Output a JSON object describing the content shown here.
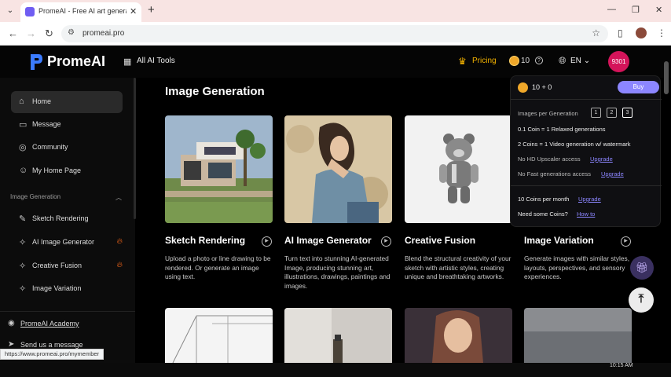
{
  "browser": {
    "tab_title": "PromeAI - Free AI art generator",
    "url": "promeai.pro",
    "status_url": "https://www.promeai.pro/mymember"
  },
  "header": {
    "logo": "PromeAI",
    "all_tools": "All AI Tools",
    "pricing": "Pricing",
    "coins": "10",
    "language": "EN",
    "user": "9301"
  },
  "sidebar": {
    "items": [
      {
        "label": "Home",
        "icon": "home-icon"
      },
      {
        "label": "Message",
        "icon": "message-icon"
      },
      {
        "label": "Community",
        "icon": "community-icon"
      },
      {
        "label": "My Home Page",
        "icon": "user-icon"
      }
    ],
    "section": "Image Generation",
    "tools": [
      {
        "label": "Sketch Rendering",
        "hot": false
      },
      {
        "label": "AI Image Generator",
        "hot": true
      },
      {
        "label": "Creative Fusion",
        "hot": true
      },
      {
        "label": "Image Variation",
        "hot": false
      }
    ],
    "academy": "PromeAI Academy",
    "send_message": "Send us a message"
  },
  "main": {
    "title": "Image Generation",
    "cards": [
      {
        "title": "Sketch Rendering",
        "desc": "Upload a photo or line drawing to be rendered. Or generate an image using text."
      },
      {
        "title": "AI Image Generator",
        "desc": "Turn text into stunning AI-generated Image, producing stunning art, illustrations, drawings, paintings and images."
      },
      {
        "title": "Creative Fusion",
        "desc": "Blend the structural creativity of your sketch with artistic styles, creating unique and breathtaking artworks."
      },
      {
        "title": "Image Variation",
        "desc": "Generate images with similar styles, layouts, perspectives, and sensory experiences."
      }
    ]
  },
  "popover": {
    "total": "10 + 0",
    "buy": "Buy",
    "images_per_generation": "Images per Generation",
    "options": [
      "1",
      "2",
      "3"
    ],
    "relaxed": "0.1 Coin = 1 Relaxed generations",
    "video": "2 Coins = 1 Video generation w/ watermark",
    "no_hd": "No HD Upscaler access",
    "no_fast": "No Fast generations access",
    "upgrade": "Upgrade",
    "per_month": "10 Coins per month",
    "need_coins": "Need some Coins?",
    "how_to": "How to"
  },
  "taskbar": {
    "clock": "10:15 AM"
  },
  "colors": {
    "accent": "#8c86ff",
    "pricing": "#f5b400",
    "user_badge": "#d4145a",
    "hot": "#ff6a1a"
  }
}
